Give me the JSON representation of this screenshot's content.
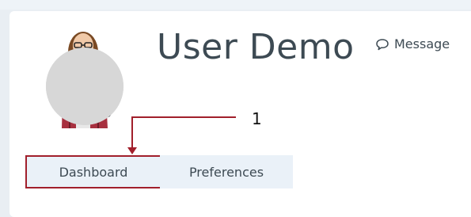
{
  "profile": {
    "name": "User Demo",
    "message_label": "Message"
  },
  "annotation": {
    "number": "1"
  },
  "tabs": [
    {
      "label": "Dashboard",
      "active": true
    },
    {
      "label": "Preferences",
      "active": false
    }
  ],
  "icons": {
    "message": "speech-bubble-icon"
  },
  "colors": {
    "accent": "#a11f2b",
    "tab_bg": "#eaf1f8",
    "text": "#3d4a53"
  }
}
